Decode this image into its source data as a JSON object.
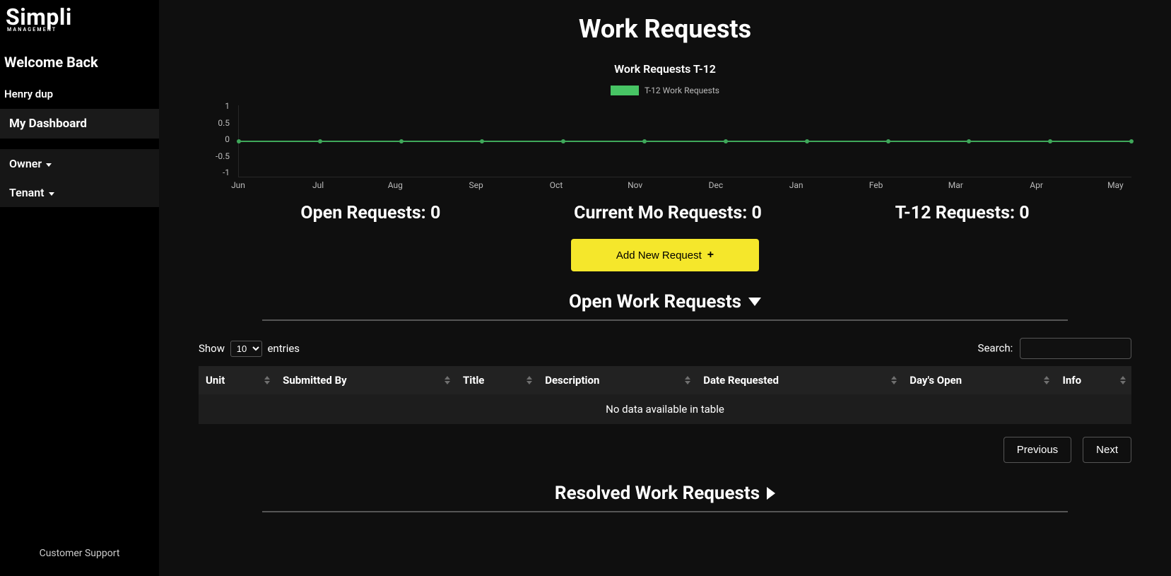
{
  "brand": {
    "name": "Simpli",
    "subtitle": "MANAGEMENT"
  },
  "sidebar": {
    "welcome": "Welcome Back",
    "username": "Henry dup",
    "items": [
      {
        "label": "My Dashboard",
        "active": true,
        "dropdown": false
      },
      {
        "label": "Owner",
        "active": false,
        "dropdown": true
      },
      {
        "label": "Tenant",
        "active": false,
        "dropdown": true
      }
    ],
    "support": "Customer Support"
  },
  "page": {
    "title": "Work Requests",
    "add_button": "Add New Request"
  },
  "chart_data": {
    "type": "line",
    "title": "Work Requests T-12",
    "legend": "T-12 Work Requests",
    "ylabel": "",
    "xlabel": "",
    "ylim": [
      -1.0,
      1.0
    ],
    "yticks": [
      1.0,
      0.5,
      0,
      -0.5,
      -1.0
    ],
    "categories": [
      "Jun",
      "Jul",
      "Aug",
      "Sep",
      "Oct",
      "Nov",
      "Dec",
      "Jan",
      "Feb",
      "Mar",
      "Apr",
      "May"
    ],
    "values": [
      0,
      0,
      0,
      0,
      0,
      0,
      0,
      0,
      0,
      0,
      0,
      0
    ]
  },
  "stats": {
    "open_label": "Open Requests:",
    "open_value": "0",
    "current_label": "Current Mo Requests:",
    "current_value": "0",
    "t12_label": "T-12 Requests:",
    "t12_value": "0"
  },
  "sections": {
    "open_title": "Open Work Requests",
    "resolved_title": "Resolved Work Requests"
  },
  "table": {
    "show_prefix": "Show",
    "show_suffix": "entries",
    "length_value": "10",
    "search_label": "Search:",
    "columns": [
      "Unit",
      "Submitted By",
      "Title",
      "Description",
      "Date Requested",
      "Day's Open",
      "Info"
    ],
    "empty": "No data available in table",
    "prev": "Previous",
    "next": "Next"
  }
}
